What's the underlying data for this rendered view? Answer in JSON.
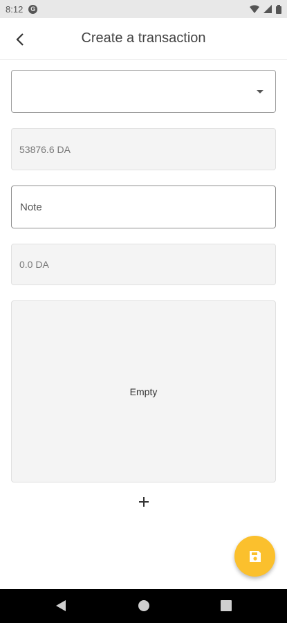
{
  "status_bar": {
    "time": "8:12",
    "app_icon_letter": "G"
  },
  "app_bar": {
    "title": "Create a transaction",
    "back_icon": "arrow-back-icon"
  },
  "form": {
    "dropdown_value": "",
    "amount_value": "53876.6 DA",
    "note_placeholder": "Note",
    "total_value": "0.0 DA"
  },
  "items": {
    "empty_label": "Empty"
  },
  "add_button_label": "+",
  "fab_icon": "save-icon",
  "colors": {
    "fab": "#fbc02d",
    "status_bar": "#e8e8e8",
    "nav_bar": "#000000"
  }
}
